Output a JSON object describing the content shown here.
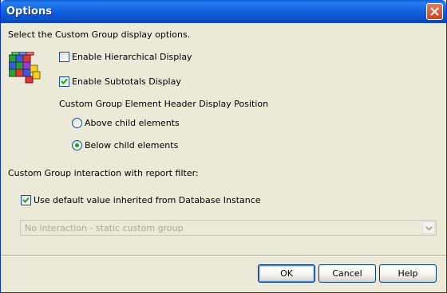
{
  "window": {
    "title": "Options"
  },
  "description": "Select the Custom Group display options.",
  "icons": {
    "app": "cube-grid-icon",
    "close": "close-icon"
  },
  "options": {
    "hierarchical": {
      "label": "Enable Hierarchical Display",
      "checked": false
    },
    "subtotals": {
      "label": "Enable Subtotals Display",
      "checked": true
    }
  },
  "header_position": {
    "label": "Custom Group Element Header Display Position",
    "choices": [
      {
        "label": "Above child elements",
        "selected": false
      },
      {
        "label": "Below child elements",
        "selected": true
      }
    ]
  },
  "interaction": {
    "label": "Custom Group interaction with report filter:",
    "use_default": {
      "label": "Use default value inherited from Database Instance",
      "checked": true
    },
    "dropdown": {
      "value": "No interaction - static custom group",
      "disabled": true
    }
  },
  "buttons": {
    "ok": "OK",
    "cancel": "Cancel",
    "help": "Help"
  },
  "colors": {
    "title_bar": "#0a52c8",
    "window_bg": "#ece9d8",
    "check_mark": "#21a121"
  }
}
